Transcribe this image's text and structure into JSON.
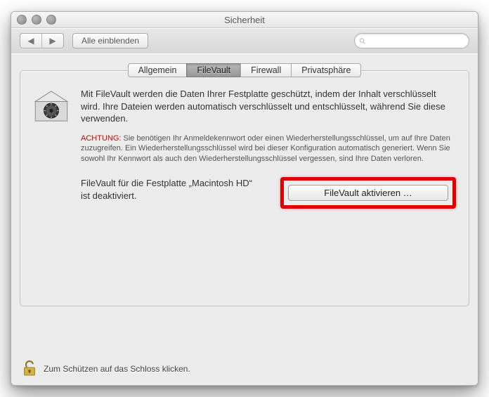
{
  "window": {
    "title": "Sicherheit"
  },
  "toolbar": {
    "show_all_label": "Alle einblenden",
    "search_placeholder": ""
  },
  "tabs": [
    {
      "label": "Allgemein",
      "selected": false
    },
    {
      "label": "FileVault",
      "selected": true
    },
    {
      "label": "Firewall",
      "selected": false
    },
    {
      "label": "Privatsphäre",
      "selected": false
    }
  ],
  "filevault": {
    "intro": "Mit FileVault werden die Daten Ihrer Festplatte geschützt, indem der Inhalt verschlüsselt wird. Ihre Dateien werden automatisch verschlüsselt und entschlüsselt, während Sie diese verwenden.",
    "warning_label": "ACHTUNG:",
    "warning_text": " Sie benötigen Ihr Anmeldekennwort oder einen Wiederherstellungsschlüssel, um auf Ihre Daten zuzugreifen. Ein Wiederherstellungsschlüssel wird bei dieser Konfiguration automatisch generiert. Wenn Sie sowohl Ihr Kennwort als auch den Wiederherstellungsschlüssel vergessen, sind Ihre Daten verloren.",
    "status_text": "FileVault für die Festplatte „Macintosh HD“ ist deaktiviert.",
    "activate_button": "FileVault aktivieren …",
    "disk_name": "Macintosh HD"
  },
  "footer": {
    "lock_hint": "Zum Schützen auf das Schloss klicken."
  },
  "colors": {
    "highlight": "#e10000",
    "warning_text": "#d40000"
  }
}
